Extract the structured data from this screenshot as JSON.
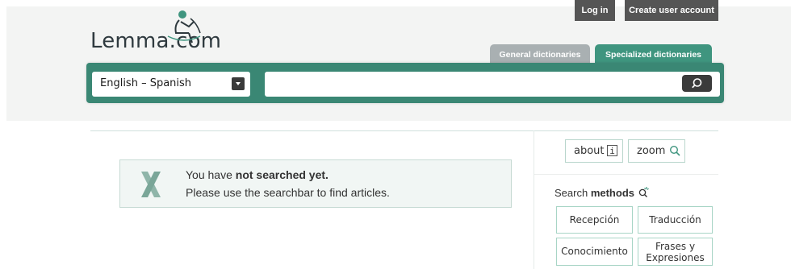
{
  "header": {
    "logo_text": "Lemma.com",
    "login_label": "Log in",
    "create_account_label": "Create user account",
    "tabs": [
      {
        "label": "General dictionaries",
        "active": false
      },
      {
        "label": "Specialized dictionaries",
        "active": true
      }
    ]
  },
  "search": {
    "language_pair": "English – Spanish",
    "query": "",
    "placeholder": "",
    "button_icon": "search-icon"
  },
  "notice": {
    "line1_prefix": "You have ",
    "line1_bold": "not searched yet.",
    "line2": "Please use the searchbar to find articles.",
    "icon": "x-icon"
  },
  "sidebar": {
    "about_label": "about",
    "about_icon_glyph": "i",
    "zoom_label": "zoom",
    "methods_prefix": "Search ",
    "methods_bold": "methods",
    "methods": [
      {
        "label": "Recepción"
      },
      {
        "label": "Traducción"
      },
      {
        "label": "Conocimiento"
      },
      {
        "line1": "Frases y",
        "line2": "Expresiones"
      }
    ]
  },
  "colors": {
    "brand_green": "#3a8774",
    "tab_active": "#3f957f",
    "tab_inactive": "#a9b0b2",
    "top_button": "#555555"
  }
}
